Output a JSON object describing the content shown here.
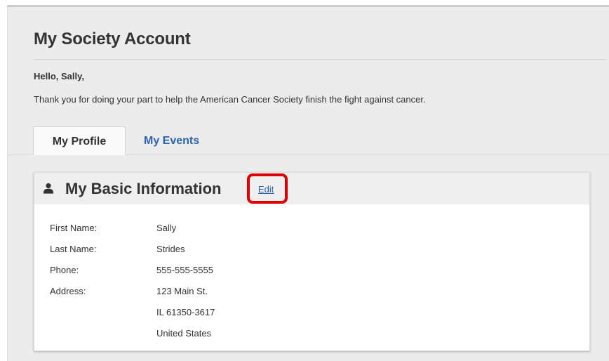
{
  "page": {
    "title": "My Society Account",
    "greeting": "Hello, Sally,",
    "intro": "Thank you for doing your part to help the American Cancer Society finish the fight against cancer."
  },
  "tabs": [
    {
      "label": "My Profile",
      "active": true
    },
    {
      "label": "My Events",
      "active": false
    }
  ],
  "card": {
    "icon": "user-icon",
    "title": "My Basic Information",
    "edit_label": "Edit",
    "fields": [
      {
        "label": "First Name:",
        "value": "Sally"
      },
      {
        "label": "Last Name:",
        "value": "Strides"
      },
      {
        "label": "Phone:",
        "value": "555-555-5555"
      },
      {
        "label": "Address:",
        "value": "123 Main St."
      },
      {
        "label": "",
        "value": "IL 61350-3617"
      },
      {
        "label": "",
        "value": "United States"
      }
    ]
  },
  "colors": {
    "link": "#2b62b3",
    "highlight": "#e10000",
    "background": "#ececec"
  }
}
